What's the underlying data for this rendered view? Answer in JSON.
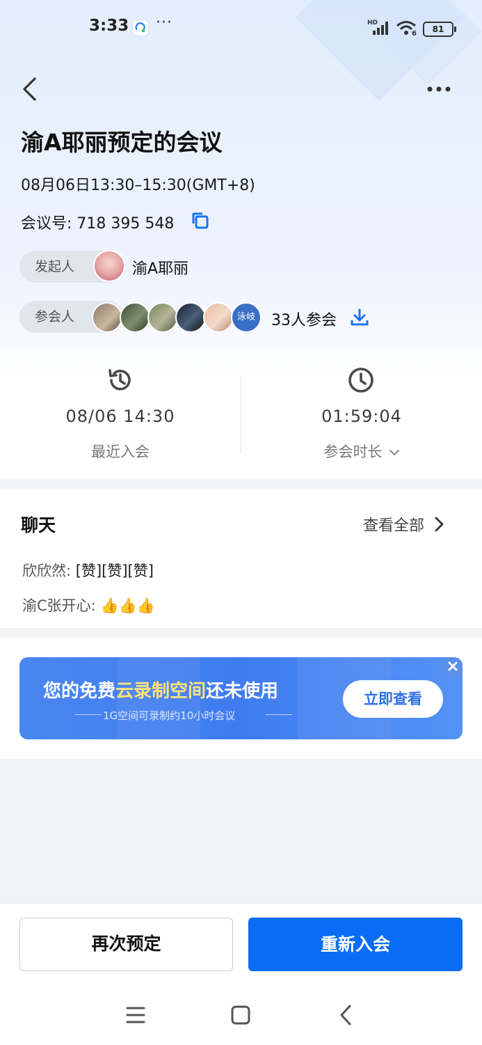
{
  "status_bar": {
    "time": "3:33",
    "more": "···",
    "network": "HD",
    "battery": "81"
  },
  "header": {
    "title": "渝A耶丽预定的会议"
  },
  "meeting": {
    "time_range": "08月06日13:30–15:30(GMT+8)",
    "number_label": "会议号:",
    "number": "718 395 548"
  },
  "host": {
    "label": "发起人",
    "name": "渝A耶丽"
  },
  "participants": {
    "label": "参会人",
    "last_avatar_text": "泳岐",
    "count": "33人参会"
  },
  "stats": {
    "recent_value": "08/06 14:30",
    "recent_label": "最近入会",
    "duration_value": "01:59:04",
    "duration_label": "参会时长"
  },
  "chat": {
    "title": "聊天",
    "see_all": "查看全部",
    "messages": [
      {
        "sender": "欣欣然:",
        "text": "[赞][赞][赞]"
      },
      {
        "sender": "渝C张开心:",
        "text": "👍👍👍"
      }
    ]
  },
  "banner": {
    "title_pre": "您的免费",
    "title_highlight": "云录制空间",
    "title_post": "还未使用",
    "subtitle": "1G空间可录制约10小时会议",
    "button": "立即查看"
  },
  "footer": {
    "rebook": "再次预定",
    "rejoin": "重新入会"
  },
  "colors": {
    "primary": "#0a6cf5",
    "banner_highlight": "#ffe27a"
  }
}
